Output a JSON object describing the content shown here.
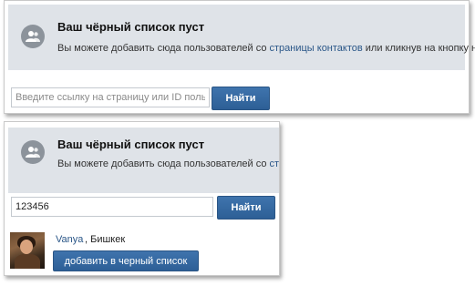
{
  "colors": {
    "notice_bg": "#dfe3e8",
    "accent_button": "#2d5f96",
    "link": "#2b5788"
  },
  "top_panel": {
    "icon": "user-silhouette-icon",
    "title": "Ваш чёрный список пуст",
    "text_before": "Вы можете добавить сюда пользователей со ",
    "link_text": "страницы контактов",
    "text_after": " или кликнув на кнопку ниже.",
    "search_placeholder": "Введите ссылку на страницу или ID пользователя",
    "search_value": "",
    "find_button": "Найти"
  },
  "bottom_panel": {
    "icon": "user-silhouette-icon",
    "title": "Ваш чёрный список пуст",
    "text_before": "Вы можете добавить сюда пользователей со ",
    "link_text": "страницы контактов",
    "search_value": "123456",
    "find_button": "Найти",
    "result": {
      "name": "Vanya",
      "city": ", Бишкек",
      "add_button": "добавить в черный список"
    }
  }
}
